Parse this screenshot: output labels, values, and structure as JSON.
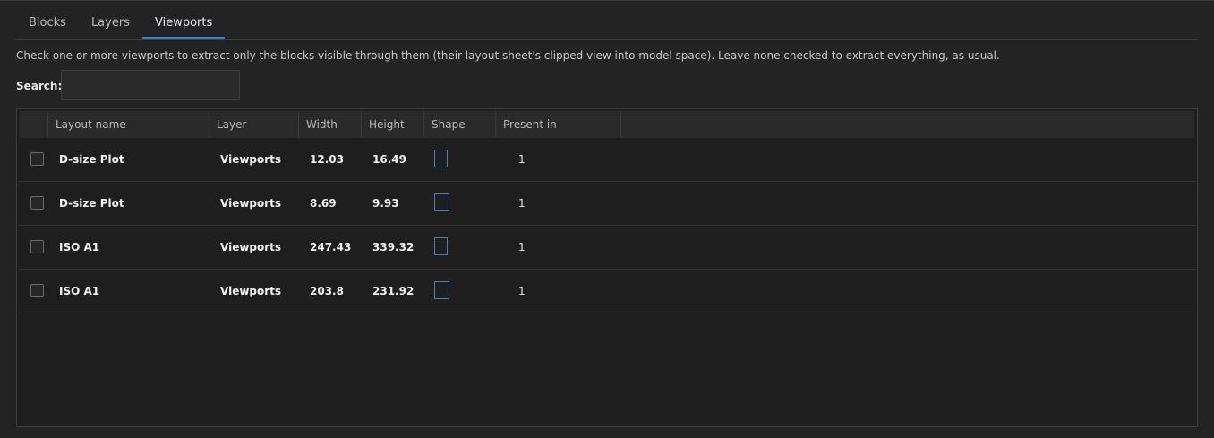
{
  "tabs": [
    {
      "label": "Blocks",
      "active": false
    },
    {
      "label": "Layers",
      "active": false
    },
    {
      "label": "Viewports",
      "active": true
    }
  ],
  "description": "Check one or more viewports to extract only the blocks visible through them (their layout sheet's clipped view into model space). Leave none checked to extract everything, as usual.",
  "search": {
    "label": "Search:",
    "value": "",
    "placeholder": ""
  },
  "table": {
    "columns": [
      "",
      "Layout name",
      "Layer",
      "Width",
      "Height",
      "Shape",
      "Present in"
    ],
    "rows": [
      {
        "checked": false,
        "layout": "D-size Plot",
        "layer": "Viewports",
        "width": "12.03",
        "height": "16.49",
        "shape": "portrait",
        "present": "1"
      },
      {
        "checked": false,
        "layout": "D-size Plot",
        "layer": "Viewports",
        "width": "8.69",
        "height": "9.93",
        "shape": "portrait",
        "present": "1"
      },
      {
        "checked": false,
        "layout": "ISO A1",
        "layer": "Viewports",
        "width": "247.43",
        "height": "339.32",
        "shape": "portrait",
        "present": "1"
      },
      {
        "checked": false,
        "layout": "ISO A1",
        "layer": "Viewports",
        "width": "203.8",
        "height": "231.92",
        "shape": "portrait",
        "present": "1"
      }
    ]
  },
  "colors": {
    "background": "#232323",
    "accent": "#2f86d6",
    "shape_outline": "#4a7fb8"
  }
}
